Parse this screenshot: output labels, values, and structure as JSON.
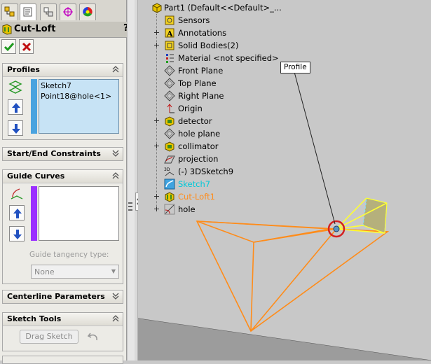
{
  "tabs": [
    {
      "name": "feature-manager-tab",
      "icon": "feature-tree-icon",
      "active": false
    },
    {
      "name": "property-manager-tab",
      "icon": "property-manager-icon",
      "active": true
    },
    {
      "name": "configuration-manager-tab",
      "icon": "configuration-icon",
      "active": false
    },
    {
      "name": "dimxpert-tab",
      "icon": "crosshair-icon",
      "active": false
    },
    {
      "name": "display-manager-tab",
      "icon": "color-wheel-icon",
      "active": false
    }
  ],
  "feature": {
    "title": "Cut-Loft",
    "help": "?"
  },
  "profiles": {
    "header": "Profiles",
    "items": [
      "Sketch7",
      "Point18@hole<1>"
    ]
  },
  "start_end": {
    "header": "Start/End Constraints"
  },
  "guide_curves": {
    "header": "Guide Curves",
    "tangency_label": "Guide tangency type:",
    "tangency_value": "None"
  },
  "centerline": {
    "header": "Centerline Parameters"
  },
  "sketch_tools": {
    "header": "Sketch Tools",
    "drag_sketch": "Drag Sketch"
  },
  "tree": {
    "root": "Part1  (Default<<Default>_...",
    "items": [
      {
        "label": "Sensors",
        "expandable": false,
        "color": "#000000"
      },
      {
        "label": "Annotations",
        "expandable": true,
        "color": "#000000"
      },
      {
        "label": "Solid Bodies(2)",
        "expandable": true,
        "color": "#000000"
      },
      {
        "label": "Material <not specified>",
        "expandable": false,
        "color": "#000000"
      },
      {
        "label": "Front Plane",
        "expandable": false,
        "color": "#000000"
      },
      {
        "label": "Top Plane",
        "expandable": false,
        "color": "#000000"
      },
      {
        "label": "Right Plane",
        "expandable": false,
        "color": "#000000"
      },
      {
        "label": "Origin",
        "expandable": false,
        "color": "#000000"
      },
      {
        "label": "detector",
        "expandable": true,
        "color": "#000000"
      },
      {
        "label": "hole plane",
        "expandable": false,
        "color": "#000000"
      },
      {
        "label": "collimator",
        "expandable": true,
        "color": "#000000"
      },
      {
        "label": "projection",
        "expandable": false,
        "color": "#000000"
      },
      {
        "label": "(-) 3DSketch9",
        "expandable": false,
        "color": "#000000"
      },
      {
        "label": "Sketch7",
        "expandable": false,
        "color": "#00c8d8"
      },
      {
        "label": "Cut-Loft1",
        "expandable": true,
        "color": "#ff8c1a"
      },
      {
        "label": "hole",
        "expandable": true,
        "color": "#000000"
      }
    ]
  },
  "callout": {
    "label": "Profile"
  },
  "colors": {
    "accent_blue": "#4aa3df",
    "guide_purple": "#9b30ff",
    "preview_orange": "#ff8c1a",
    "sketch_yellow": "#ffff33",
    "selection_red": "#d42020"
  }
}
